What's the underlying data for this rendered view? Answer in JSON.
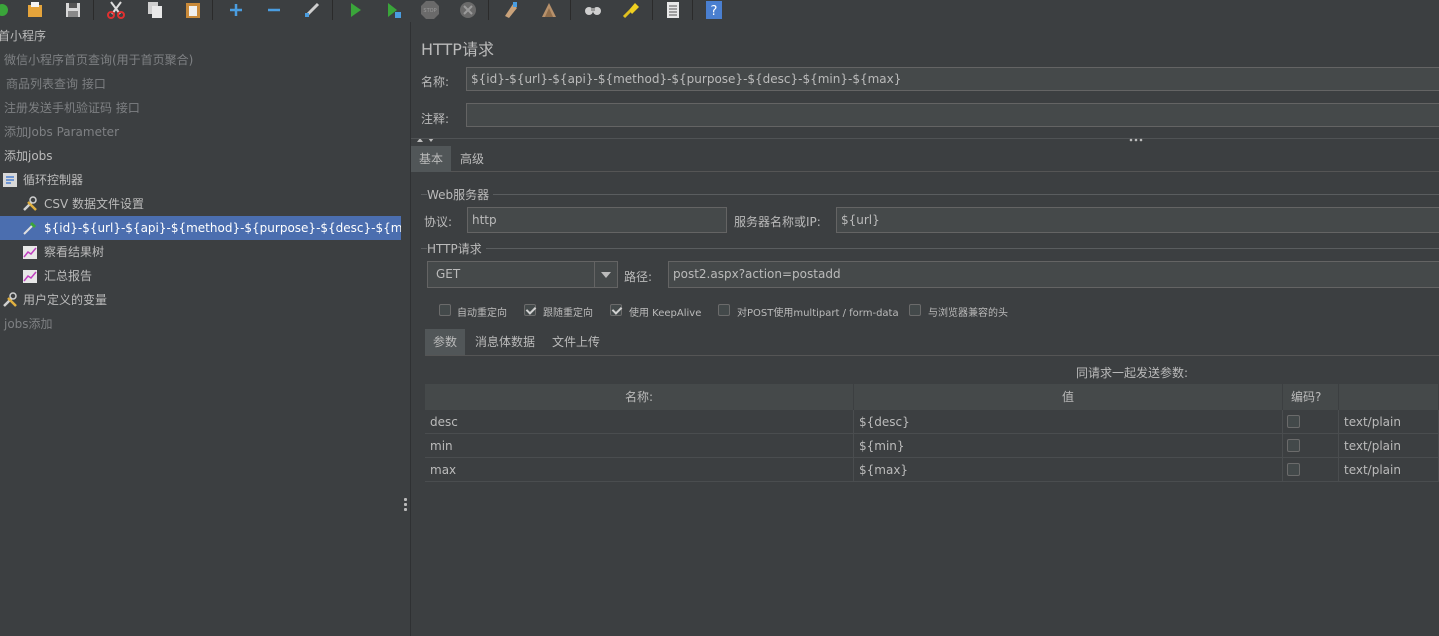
{
  "toolbar": {
    "icons": [
      "new-icon",
      "open-icon",
      "save-icon",
      "cut-icon",
      "copy-icon",
      "paste-icon",
      "add-icon",
      "remove-icon",
      "toggle-icon",
      "start-icon",
      "start-no-pause-icon",
      "stop-icon",
      "shutdown-icon",
      "clear-icon",
      "clear-all-icon",
      "search-icon",
      "reset-search-icon",
      "function-helper-icon",
      "help-icon"
    ],
    "stop_label": "STOP"
  },
  "tree": {
    "items": [
      {
        "label": "首小程序"
      },
      {
        "label": "微信小程序首页查询(用于首页聚合)"
      },
      {
        "label": "商品列表查询 接口"
      },
      {
        "label": "注册发送手机验证码 接口"
      },
      {
        "label": "添加Jobs Parameter"
      },
      {
        "label": "添加jobs"
      },
      {
        "label": "循环控制器"
      },
      {
        "label": "CSV 数据文件设置"
      },
      {
        "label": "${id}-${url}-${api}-${method}-${purpose}-${desc}-${min}-${max}"
      },
      {
        "label": "察看结果树"
      },
      {
        "label": "汇总报告"
      },
      {
        "label": "用户定义的变量"
      },
      {
        "label": "jobs添加"
      }
    ]
  },
  "panel": {
    "title": "HTTP请求",
    "name_label": "名称:",
    "name_value": "${id}-${url}-${api}-${method}-${purpose}-${desc}-${min}-${max}",
    "comment_label": "注释:",
    "comment_value": "",
    "tabs": [
      "基本",
      "高级"
    ],
    "web_server": {
      "title": "Web服务器",
      "protocol_label": "协议:",
      "protocol_value": "http",
      "server_label": "服务器名称或IP:",
      "server_value": "${url}"
    },
    "http_request": {
      "title": "HTTP请求",
      "method": "GET",
      "path_label": "路径:",
      "path_value": "post2.aspx?action=postadd"
    },
    "options": [
      {
        "label": "自动重定向",
        "checked": false
      },
      {
        "label": "跟随重定向",
        "checked": true
      },
      {
        "label": "使用 KeepAlive",
        "checked": true
      },
      {
        "label": "对POST使用multipart / form-data",
        "checked": false
      },
      {
        "label": "与浏览器兼容的头",
        "checked": false
      }
    ],
    "subtabs": [
      "参数",
      "消息体数据",
      "文件上传"
    ],
    "params_caption": "同请求一起发送参数:",
    "columns": [
      "名称:",
      "值",
      "编码?",
      ""
    ],
    "rows": [
      {
        "name": "desc",
        "value": "${desc}",
        "encode": false,
        "type": "text/plain"
      },
      {
        "name": "min",
        "value": "${min}",
        "encode": false,
        "type": "text/plain"
      },
      {
        "name": "max",
        "value": "${max}",
        "encode": false,
        "type": "text/plain"
      }
    ]
  }
}
